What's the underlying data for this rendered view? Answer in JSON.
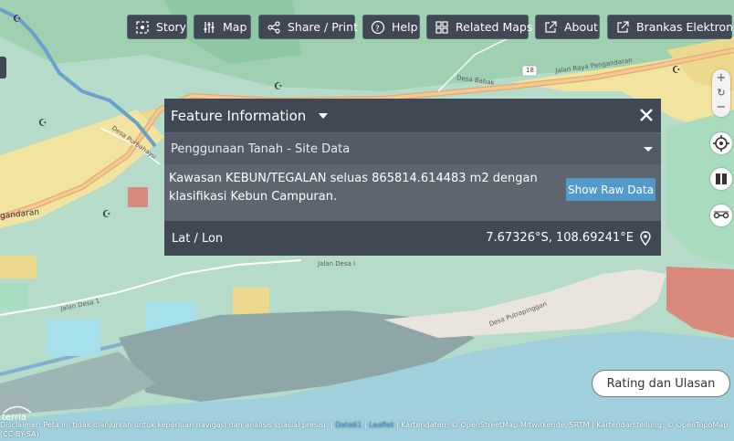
{
  "toolbar": {
    "story": "Story",
    "map": "Map",
    "share": "Share / Print",
    "help": "Help",
    "related_maps": "Related Maps",
    "about": "About",
    "brankas": "Brankas Elektronik"
  },
  "feature_info": {
    "title": "Feature Information",
    "section": "Penggunaan Tanah - Site Data",
    "description": "Kawasan KEBUN/TEGALAN seluas 865814.614483 m2 dengan klasifikasi Kebun Campuran.",
    "raw_button": "Show Raw Data",
    "latlon_label": "Lat / Lon",
    "latlon_value": "7.67326°S, 108.69241°E"
  },
  "map_labels": {
    "road_main": "Jalan Raya Pangandaran",
    "road_num": "18",
    "desa_babakan": "Desa Babak",
    "jalan_desa": "Jalan Desa I",
    "jalan_desa_1": "Jalan Desa 1",
    "desa_purbahayu": "Desa Purbahayu",
    "desa_putrapinggan": "Desa Putrapinggan",
    "pangandaran": "gandaran"
  },
  "rating_button": "Rating dan Ulasan",
  "logo_text": "terria",
  "footer": {
    "disclaimer": "Disclaimer: Peta ini tidak dianjurkan untuk keperluan navigasi dan analisis spasial presisi.",
    "sep1": "|",
    "data61": "Data61",
    "sep2": "|",
    "leaflet": "Leaflet",
    "attribution": "| Kartendaten: © OpenStreetMap-Mitwirkende, SRTM | Kartendarstellung: © OpenTopoMap (CC-BY-SA)"
  },
  "colors": {
    "panel_dark": "#3f4854",
    "panel_mid": "#525b67",
    "panel_body": "#5c6570",
    "accent_button": "#519ac9",
    "map_green": "#b6dcc9",
    "sea": "#9fd0dc"
  }
}
